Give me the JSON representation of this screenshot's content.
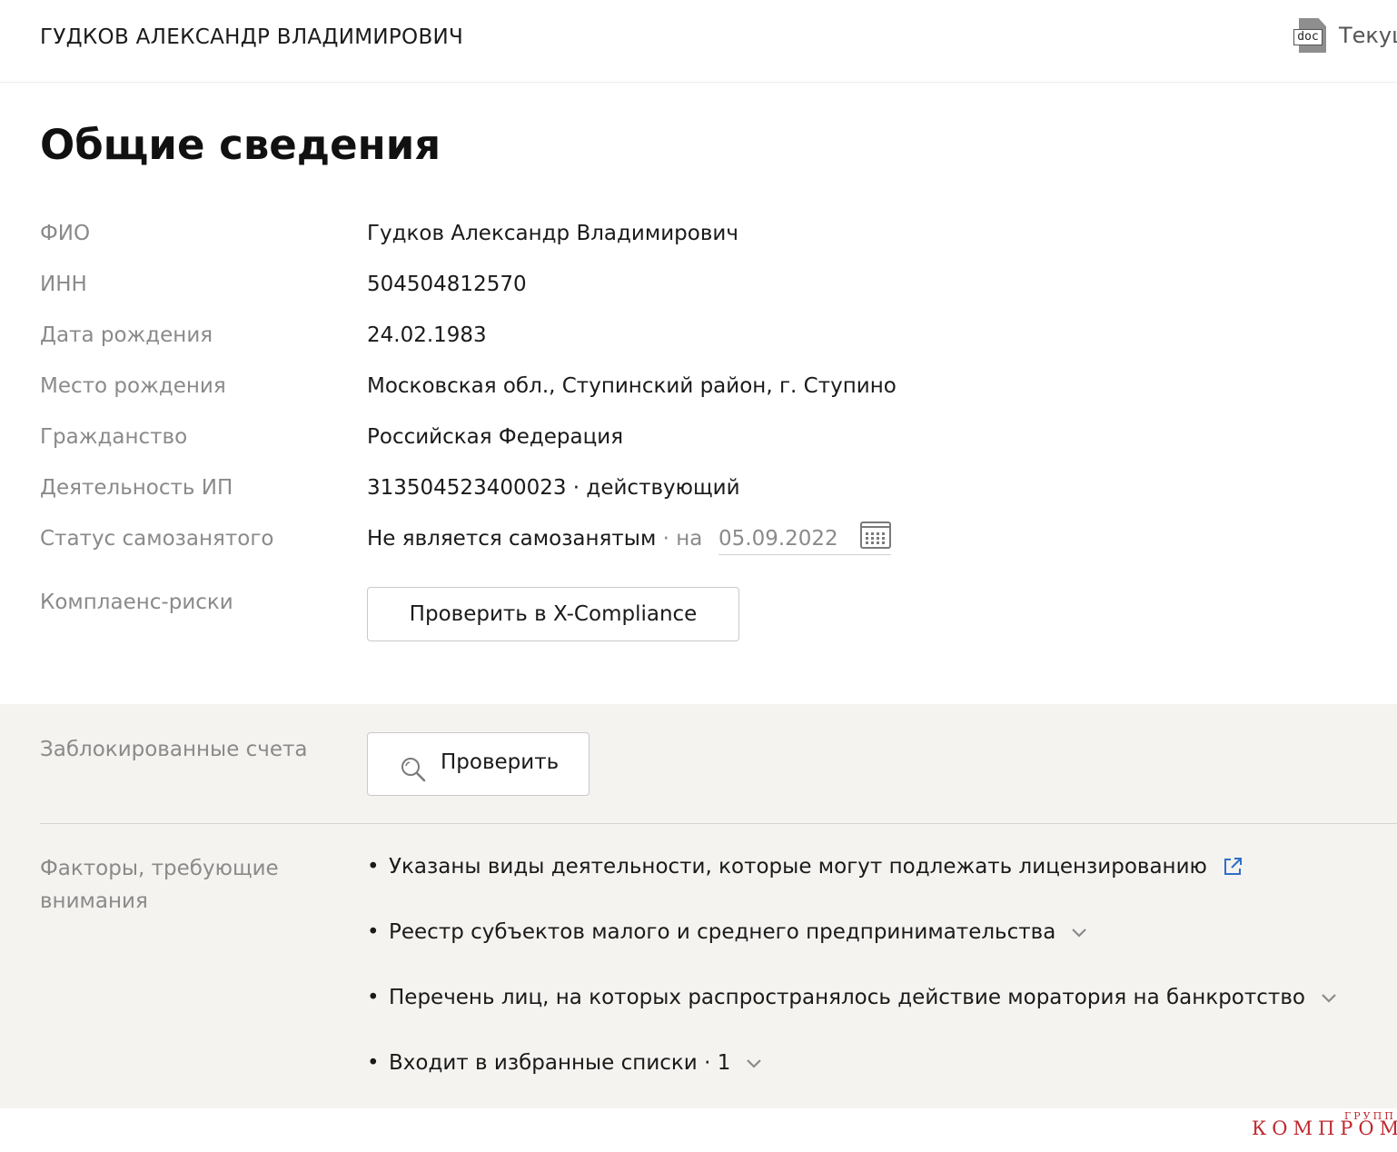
{
  "header": {
    "title": "ГУДКОВ АЛЕКСАНДР ВЛАДИМИРОВИЧ",
    "doc_icon_label": "doc",
    "doc_link_text": "Текущ"
  },
  "section": {
    "title": "Общие сведения"
  },
  "info": {
    "fio_label": "ФИО",
    "fio_value": "Гудков Александр Владимирович",
    "inn_label": "ИНН",
    "inn_value": "504504812570",
    "birth_date_label": "Дата рождения",
    "birth_date_value": "24.02.1983",
    "birth_place_label": "Место рождения",
    "birth_place_value": "Московская обл., Ступинский район, г. Ступино",
    "citizenship_label": "Гражданство",
    "citizenship_value": "Российская Федерация",
    "ip_label": "Деятельность ИП",
    "ip_value": "313504523400023 · действующий",
    "selfemployed_label": "Статус самозанятого",
    "selfemployed_value": "Не является самозанятым",
    "selfemployed_sep": " · на",
    "selfemployed_date": "05.09.2022",
    "compliance_label": "Комплаенс-риски",
    "compliance_button": "Проверить в X-Compliance"
  },
  "panel": {
    "blocked_label": "Заблокированные счета",
    "check_button": "Проверить",
    "factors_label_line1": "Факторы, требующие",
    "factors_label_line2": "внимания",
    "factors": [
      "Указаны виды деятельности, которые могут подлежать лицензированию",
      "Реестр субъектов малого и среднего предпринимательства",
      "Перечень лиц, на которых распространялось действие моратория на банкротство",
      "Входит в избранные списки · 1"
    ]
  },
  "colors": {
    "link": "#2f6fc6",
    "muted_label": "#8a8a8a",
    "panel_bg": "#f4f3f0",
    "watermark": "#c0282e"
  },
  "watermark": {
    "main": "КОМПРОМАТ",
    "small": "ГРУПП"
  }
}
